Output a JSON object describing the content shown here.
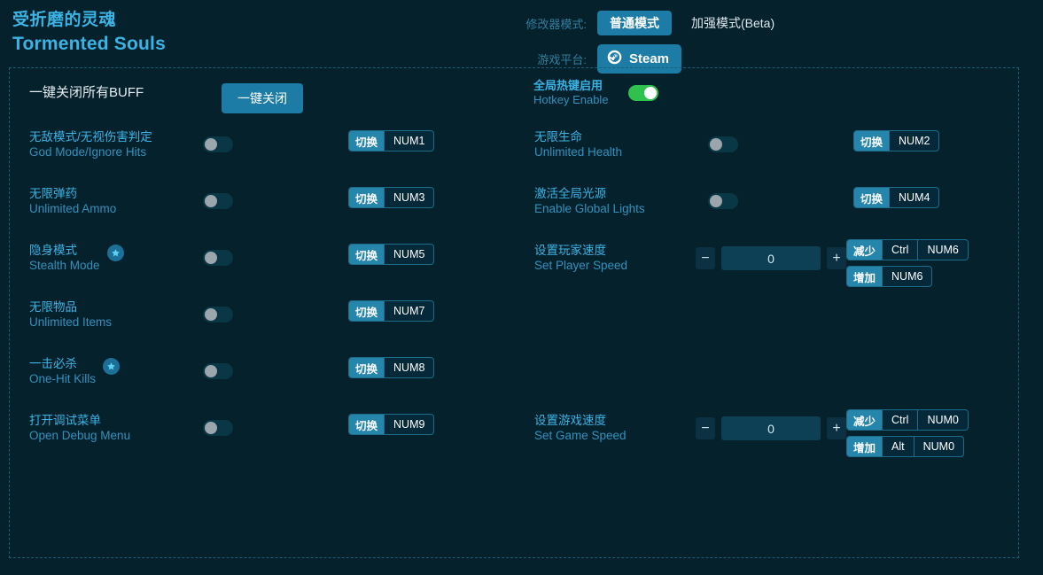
{
  "header": {
    "game_title_cn": "受折磨的灵魂",
    "game_title_en": "Tormented Souls",
    "mode_label": "修改器模式:",
    "mode_normal": "普通模式",
    "mode_enhanced": "加强模式(Beta)",
    "platform_label": "游戏平台:",
    "platform_name": "Steam",
    "platform_icon": "steam-icon",
    "accent_color": "#1c7ca5",
    "text_color": "#3bb3e4"
  },
  "toolbar": {
    "all_off_label": "一键关闭所有BUFF",
    "all_off_button": "一键关闭",
    "hotkey_cn": "全局热键启用",
    "hotkey_en": "Hotkey Enable",
    "hotkey_enabled": true,
    "toggle_on_color": "#2ec14e"
  },
  "cheats": {
    "left": [
      {
        "name_cn": "无敌模式/无视伤害判定",
        "name_en": "God Mode/Ignore Hits",
        "star": false,
        "enabled": false,
        "hotkeys": [
          {
            "action": "切换",
            "keys": [
              "NUM1"
            ]
          }
        ]
      },
      {
        "name_cn": "无限弹药",
        "name_en": "Unlimited Ammo",
        "star": false,
        "enabled": false,
        "hotkeys": [
          {
            "action": "切换",
            "keys": [
              "NUM3"
            ]
          }
        ]
      },
      {
        "name_cn": "隐身模式",
        "name_en": "Stealth Mode",
        "star": true,
        "enabled": false,
        "hotkeys": [
          {
            "action": "切换",
            "keys": [
              "NUM5"
            ]
          }
        ]
      },
      {
        "name_cn": "无限物品",
        "name_en": "Unlimited Items",
        "star": false,
        "enabled": false,
        "hotkeys": [
          {
            "action": "切换",
            "keys": [
              "NUM7"
            ]
          }
        ]
      },
      {
        "name_cn": "一击必杀",
        "name_en": "One-Hit Kills",
        "star": true,
        "enabled": false,
        "hotkeys": [
          {
            "action": "切换",
            "keys": [
              "NUM8"
            ]
          }
        ]
      },
      {
        "name_cn": "打开调试菜单",
        "name_en": "Open Debug Menu",
        "star": false,
        "enabled": false,
        "hotkeys": [
          {
            "action": "切换",
            "keys": [
              "NUM9"
            ]
          }
        ]
      }
    ],
    "right": [
      {
        "name_cn": "无限生命",
        "name_en": "Unlimited Health",
        "star": false,
        "enabled": false,
        "hotkeys": [
          {
            "action": "切换",
            "keys": [
              "NUM2"
            ]
          }
        ]
      },
      {
        "name_cn": "激活全局光源",
        "name_en": "Enable Global Lights",
        "star": false,
        "enabled": false,
        "hotkeys": [
          {
            "action": "切换",
            "keys": [
              "NUM4"
            ]
          }
        ]
      },
      {
        "name_cn": "设置玩家速度",
        "name_en": "Set Player Speed",
        "star": false,
        "type": "stepper",
        "value": "0",
        "minus": "−",
        "plus": "+",
        "hotkeys": [
          {
            "action": "减少",
            "keys": [
              "Ctrl",
              "NUM6"
            ]
          },
          {
            "action": "增加",
            "keys": [
              "NUM6"
            ]
          }
        ]
      },
      {
        "name_cn": "设置游戏速度",
        "name_en": "Set Game Speed",
        "star": false,
        "type": "stepper",
        "value": "0",
        "minus": "−",
        "plus": "+",
        "hotkeys": [
          {
            "action": "减少",
            "keys": [
              "Ctrl",
              "NUM0"
            ]
          },
          {
            "action": "增加",
            "keys": [
              "Alt",
              "NUM0"
            ]
          }
        ]
      }
    ]
  }
}
